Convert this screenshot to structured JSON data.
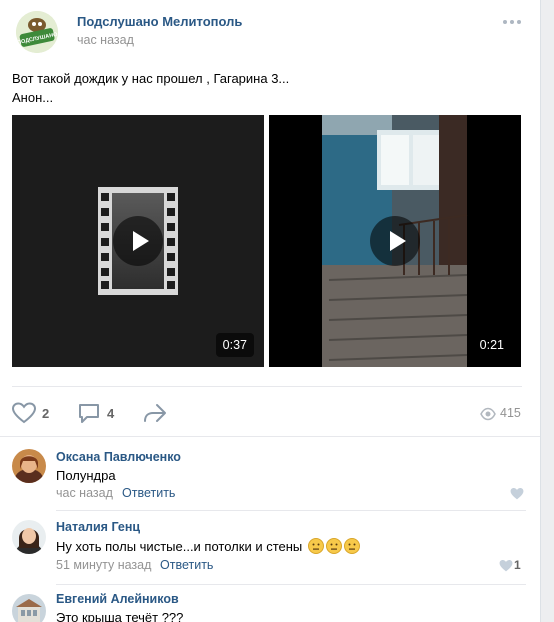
{
  "group": {
    "name": "Подслушано Мелитополь",
    "time": "час назад",
    "avatar_text": "ПОДСЛУШАНО МЕЛИТОПОЛЬ"
  },
  "post": {
    "text_line1": "Вот такой дождик у нас прошел , Гагарина 3...",
    "text_line2": "Анон..."
  },
  "videos": [
    {
      "duration": "0:37",
      "icon": "film-strip-icon"
    },
    {
      "duration": "0:21",
      "icon": "stairwell-thumbnail"
    }
  ],
  "actions": {
    "likes": "2",
    "comments": "4",
    "views": "415"
  },
  "comments": [
    {
      "author": "Оксана Павлюченко",
      "text": "Полундра",
      "time": "час назад",
      "reply_label": "Ответить",
      "likes": ""
    },
    {
      "author": "Наталия Генц",
      "text": "Ну хоть полы чистые...и потолки и стены",
      "emoji": [
        "😐",
        "😐",
        "😐"
      ],
      "time": "51 минуту назад",
      "reply_label": "Ответить",
      "likes": "1"
    },
    {
      "author": "Евгений Алейников",
      "text": "Это крыша течёт ???"
    }
  ],
  "colors": {
    "link": "#2a5885",
    "muted": "#939393",
    "background": "#edeef0"
  }
}
